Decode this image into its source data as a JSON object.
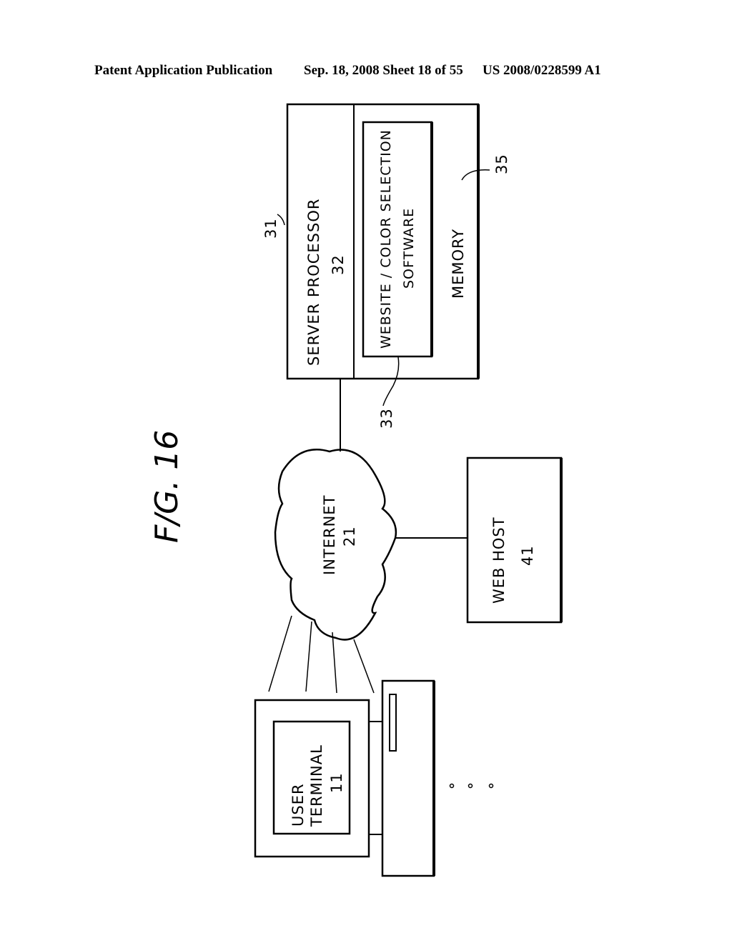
{
  "header": {
    "publication": "Patent Application Publication",
    "date_sheet": "Sep. 18, 2008   Sheet 18 of 55",
    "patent_number": "US 2008/0228599 A1"
  },
  "figure": {
    "title": "F/G. 16",
    "server": {
      "ref": "31",
      "processor_label": "SERVER  PROCESSOR",
      "processor_ref": "32",
      "software_line1": "WEBSITE / COLOR  SELECTION",
      "software_line2": "SOFTWARE",
      "software_ref": "33",
      "memory_label": "MEMORY",
      "memory_ref": "35"
    },
    "internet": {
      "label": "INTERNET",
      "ref": "21"
    },
    "web_host": {
      "label": "WEB  HOST",
      "ref": "41"
    },
    "user_terminal": {
      "line1": "USER",
      "line2": "TERMINAL",
      "ref": "11"
    },
    "ellipsis": "• • •"
  }
}
